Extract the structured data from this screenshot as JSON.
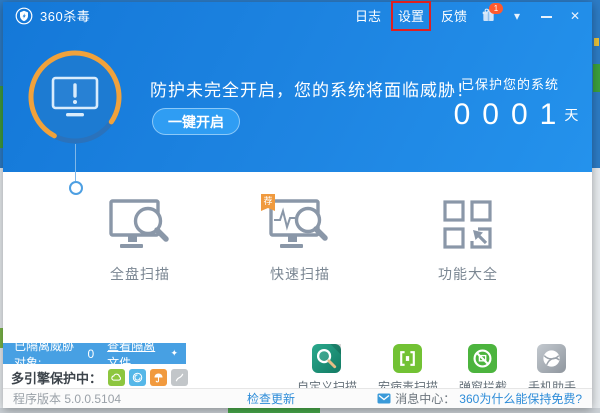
{
  "colors": {
    "titlebar_blue": "#1e80dd",
    "banner_gradient_start": "#1478d8",
    "banner_gradient_end": "#2492ec",
    "ring_orange": "#f0a23c",
    "action_button_blue": "#2f9df3",
    "quarantine_bar_blue": "#47a0e3",
    "link_blue": "#2d8cd8",
    "annotation_red": "#e01f1f",
    "engine_cloud_green": "#8dc63f",
    "engine_qvm_blue": "#55b7e8",
    "engine_avira_orange": "#f19a3e",
    "engine_bitdefender_gray": "#c2c6c9"
  },
  "titlebar": {
    "app_name": "360杀毒",
    "menu": [
      {
        "label": "日志"
      },
      {
        "label": "设置",
        "highlighted": true
      },
      {
        "label": "反馈"
      }
    ],
    "gift_badge": "1",
    "controls": {
      "dropdown": "▾",
      "close": "✕"
    }
  },
  "banner": {
    "headline": "防护未完全开启，您的系统将面临威胁！",
    "action_button": "一键开启",
    "protected_caption": "已保护您的系统",
    "protected_days": "0001",
    "days_unit": "天"
  },
  "scan_options": [
    {
      "label": "全盘扫描",
      "icon": "full-scan-icon"
    },
    {
      "label": "快速扫描",
      "icon": "quick-scan-icon",
      "badge": "荐"
    },
    {
      "label": "功能大全",
      "icon": "toolbox-icon"
    }
  ],
  "quarantine": {
    "label": "已隔离威胁对象:",
    "count": "0",
    "link": "查看隔离文件",
    "link_icon": "✦"
  },
  "engines": {
    "label": "多引擎保护中：",
    "items": [
      {
        "name": "cloud-engine"
      },
      {
        "name": "qvm-engine"
      },
      {
        "name": "avira-engine"
      },
      {
        "name": "bitdefender-engine"
      }
    ]
  },
  "shortcuts": [
    {
      "label": "自定义扫描",
      "icon": "custom-scan-icon"
    },
    {
      "label": "宏病毒扫描",
      "icon": "macro-scan-icon"
    },
    {
      "label": "弹窗拦截",
      "icon": "popup-block-icon"
    },
    {
      "label": "手机助手",
      "icon": "phone-assistant-icon"
    }
  ],
  "statusbar": {
    "version": "程序版本 5.0.0.5104",
    "update_link": "检查更新",
    "message_center_label": "消息中心：",
    "message_link": "360为什么能保持免费?"
  }
}
